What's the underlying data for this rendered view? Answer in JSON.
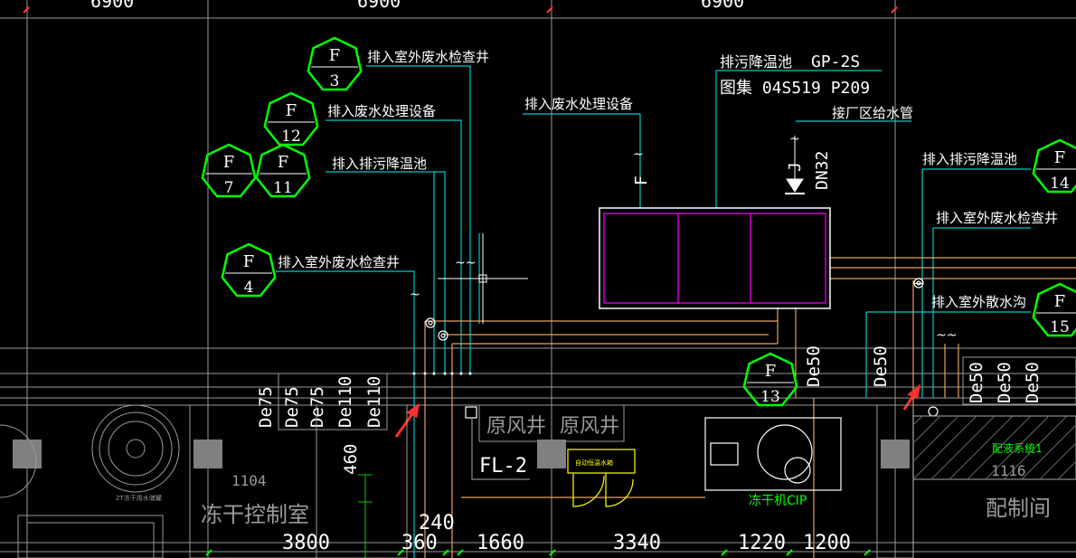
{
  "dimensions_top": [
    "6900",
    "6900",
    "6900"
  ],
  "hexagon_tags": [
    {
      "id": "f3",
      "letter": "F",
      "number": "3",
      "label": "排入室外废水检查井"
    },
    {
      "id": "f12",
      "letter": "F",
      "number": "12",
      "label": "排入废水处理设备"
    },
    {
      "id": "f7",
      "letter": "F",
      "number": "7",
      "label": ""
    },
    {
      "id": "f11",
      "letter": "F",
      "number": "11",
      "label": "排入排污降温池"
    },
    {
      "id": "f4",
      "letter": "F",
      "number": "4",
      "label": "排入室外废水检查井"
    },
    {
      "id": "f13",
      "letter": "F",
      "number": "13",
      "label": ""
    },
    {
      "id": "f14",
      "letter": "F",
      "number": "14",
      "label": "排入排污降温池"
    },
    {
      "id": "f15",
      "letter": "F",
      "number": "15",
      "label": "排入室外散水沟"
    }
  ],
  "annotations": {
    "to_treatment": "排入废水处理设备",
    "tank_title": "排污降温池",
    "tank_code": "GP-2S",
    "tank_atlas": "图集 04S519 P209",
    "to_water": "接厂区给水管",
    "tag_f": "F",
    "tag_j": "J",
    "dn32": "DN32",
    "outdoor_well_right": "排入室外废水检查井"
  },
  "pipe_sizes_left": [
    "De75",
    "De75",
    "De75",
    "De110",
    "De110"
  ],
  "pipe_sizes_right": [
    "De50",
    "De50",
    "De50"
  ],
  "pipe_size_mid": "De50",
  "pipe_size_mid2": "De50",
  "rooms": {
    "freeze_control": "冻干控制室",
    "freeze_control_no": "1104",
    "air_shaft_1": "原风井",
    "air_shaft_2": "原风井",
    "fl2": "FL-2",
    "mixing_room": "配制间",
    "mixing_room_no": "1116",
    "mixing_system": "配液系统1",
    "freeze_machine": "冻干机CIP",
    "small_label": "2T冻干用水储罐",
    "yellow_label": "自动恒温水箱",
    "dim_460": "460"
  },
  "dimensions_bottom": [
    "3800",
    "360",
    "240",
    "1660",
    "3340",
    "1220",
    "1200"
  ],
  "colors": {
    "hexagon": "#00ff00",
    "text": "#ffffff",
    "cyan_line": "#00c8c8",
    "orange_line": "#e8a060",
    "magenta": "#ff00ff",
    "arrow": "#ff3030",
    "grid": "#9a9a9a",
    "yellow": "#ffff00"
  }
}
